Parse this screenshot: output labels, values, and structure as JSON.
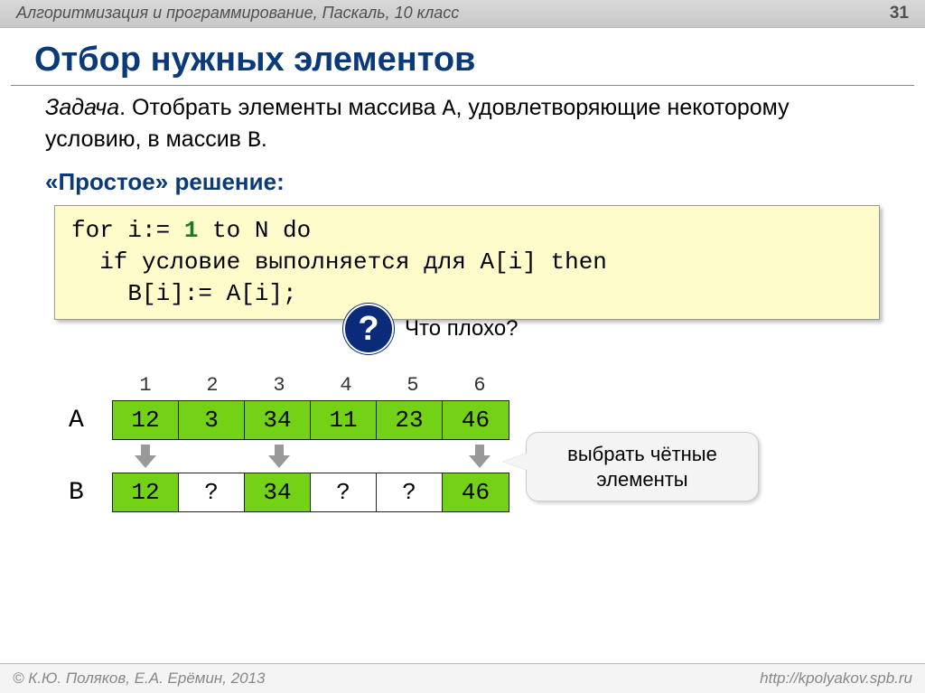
{
  "header": {
    "breadcrumb": "Алгоритмизация и программирование, Паскаль, 10 класс",
    "page": "31"
  },
  "title": "Отбор нужных элементов",
  "task": {
    "label": "Задача",
    "text1": ". Отобрать элементы массива ",
    "arrA": "A",
    "text2": ", удовлетворяющие некоторому условию, в массив ",
    "arrB": "B",
    "dot": "."
  },
  "subtitle": "«Простое» решение:",
  "code": {
    "l1a": "for i:= ",
    "l1num": "1",
    "l1b": " to N do",
    "l2": "  if условие выполняется для A[i] then",
    "l3": "    B[i]:= A[i];"
  },
  "question": {
    "mark": "?",
    "text": "Что плохо?"
  },
  "indices": [
    "1",
    "2",
    "3",
    "4",
    "5",
    "6"
  ],
  "arrayA": {
    "label": "A",
    "cells": [
      {
        "v": "12",
        "cls": "green"
      },
      {
        "v": "3",
        "cls": "green"
      },
      {
        "v": "34",
        "cls": "green"
      },
      {
        "v": "11",
        "cls": "green"
      },
      {
        "v": "23",
        "cls": "green"
      },
      {
        "v": "46",
        "cls": "green"
      }
    ]
  },
  "arrows": [
    true,
    false,
    true,
    false,
    false,
    true
  ],
  "arrayB": {
    "label": "B",
    "cells": [
      {
        "v": "12",
        "cls": "green"
      },
      {
        "v": "?",
        "cls": "white"
      },
      {
        "v": "34",
        "cls": "green"
      },
      {
        "v": "?",
        "cls": "white"
      },
      {
        "v": "?",
        "cls": "white"
      },
      {
        "v": "46",
        "cls": "green"
      }
    ]
  },
  "callout": "выбрать чётные элементы",
  "footer": {
    "left": "© К.Ю. Поляков, Е.А. Ерёмин, 2013",
    "right": "http://kpolyakov.spb.ru"
  }
}
